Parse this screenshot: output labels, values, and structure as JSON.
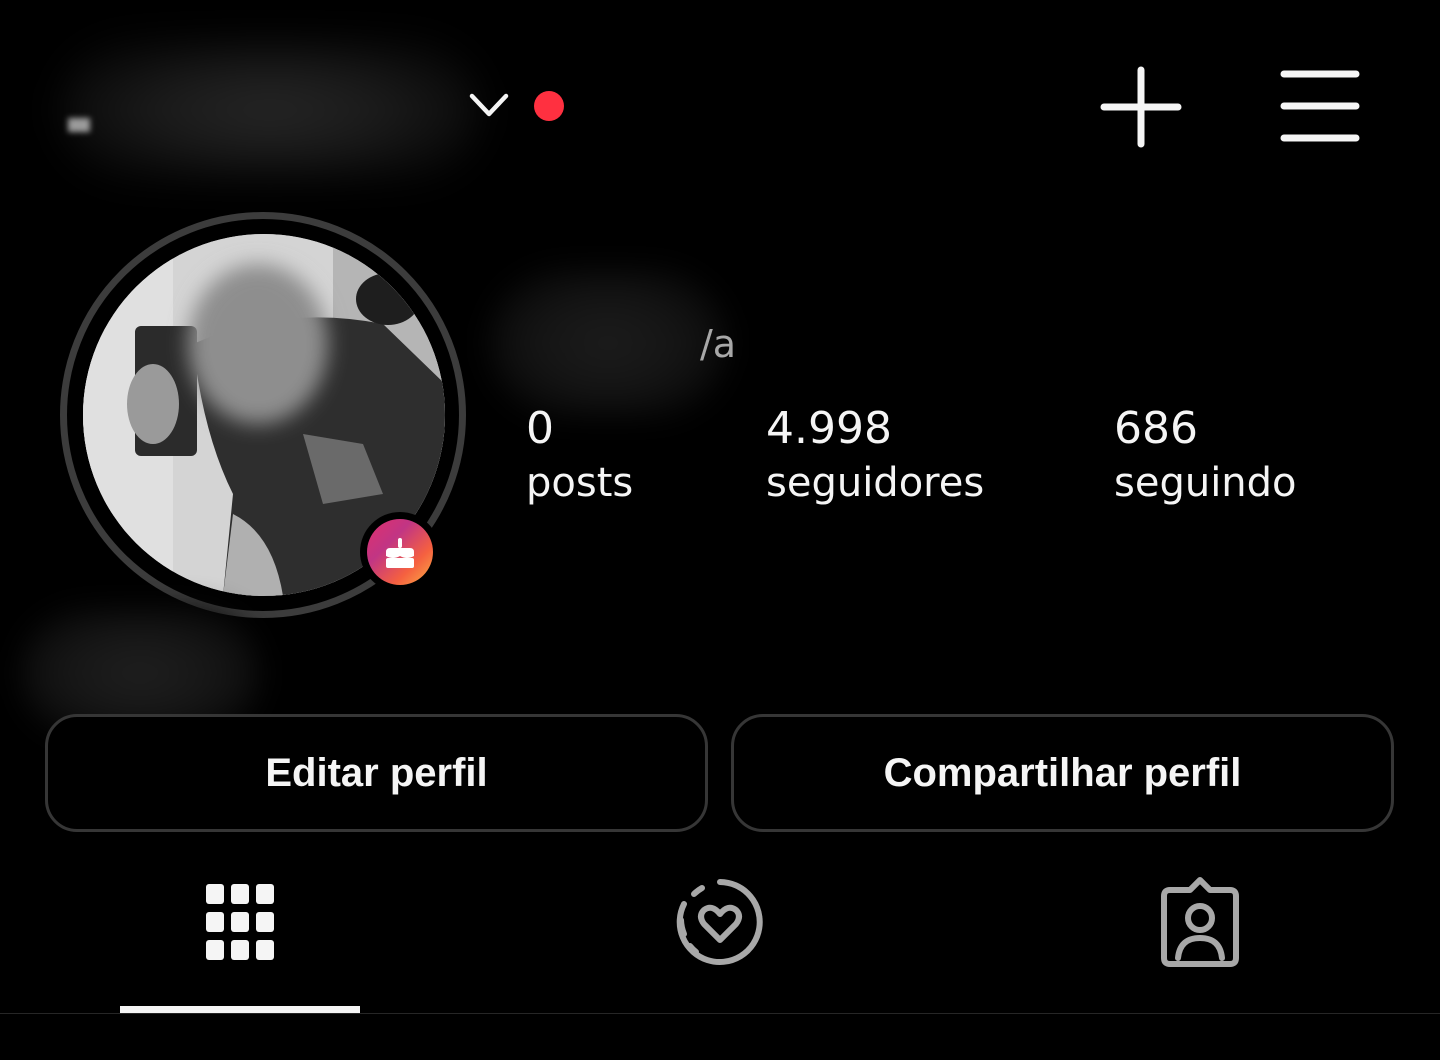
{
  "header": {
    "username": "",
    "icons": {
      "account_switch": "chevron-down-icon",
      "notification": "red-dot-indicator",
      "create": "plus-icon",
      "menu": "hamburger-menu-icon"
    },
    "notification_color": "#ff3040"
  },
  "profile": {
    "display_name": "",
    "pronouns": "/a",
    "bio": "",
    "badge_icon": "birthday-cake-icon",
    "stats": [
      {
        "value": "0",
        "label": "posts"
      },
      {
        "value": "4.998",
        "label": "seguidores"
      },
      {
        "value": "686",
        "label": "seguindo"
      }
    ]
  },
  "actions": {
    "edit_label": "Editar perfil",
    "share_label": "Compartilhar perfil"
  },
  "tabs": [
    {
      "icon": "grid-icon",
      "active": true
    },
    {
      "icon": "reels-heart-icon",
      "active": false
    },
    {
      "icon": "tagged-person-icon",
      "active": false
    }
  ],
  "colors": {
    "background": "#000000",
    "text": "#f5f5f5",
    "muted_text": "#a8a8a8",
    "button_border": "#363636",
    "accent_gradient": [
      "#c13584",
      "#f56040",
      "#fcaf45"
    ]
  }
}
